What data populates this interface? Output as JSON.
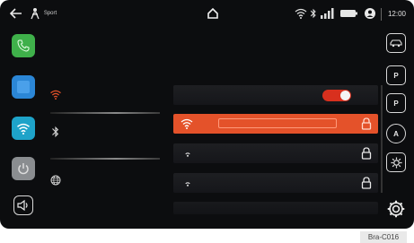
{
  "status_bar": {
    "back_icon": "back-arrow-icon",
    "profile_icon": "driving-profile-icon",
    "profile_label": "Sport",
    "home_icon": "home-icon",
    "wifi_icon": "wifi-icon",
    "bluetooth_icon": "bluetooth-icon",
    "signal_icon": "signal-bars-icon",
    "battery_icon": "battery-icon",
    "user_icon": "user-icon",
    "clock": "12:00"
  },
  "left_rail": [
    {
      "id": "phone",
      "icon": "phone-icon",
      "color": "#3fb04a"
    },
    {
      "id": "app",
      "icon": "app-tile-icon",
      "color": "#2b86d6"
    },
    {
      "id": "wifi",
      "icon": "wifi-icon",
      "color": "#1ea3c9"
    },
    {
      "id": "power",
      "icon": "power-icon",
      "color": "#8a8d90"
    },
    {
      "id": "volume",
      "icon": "speaker-icon",
      "color": "#0c0d0f"
    }
  ],
  "settings_menu": [
    {
      "id": "wifi",
      "icon": "wifi-icon",
      "color": "#e4522a"
    },
    {
      "id": "bluetooth",
      "icon": "bluetooth-icon",
      "color": "#d0d0d0"
    },
    {
      "id": "internet",
      "icon": "globe-icon",
      "color": "#d0d0d0"
    }
  ],
  "wifi_panel": {
    "toggle_state": "on",
    "accent": "#e4522a"
  },
  "right_rail": [
    {
      "id": "car",
      "icon": "car-icon"
    },
    {
      "id": "parking",
      "label": "P",
      "icon": "parking-sensor-icon"
    },
    {
      "id": "park-assist",
      "label": "P",
      "icon": "park-assist-icon"
    },
    {
      "id": "auto",
      "label": "A",
      "icon": "auto-start-stop-icon"
    },
    {
      "id": "gear",
      "icon": "gear-icon"
    },
    {
      "id": "settings",
      "icon": "settings-cog-icon"
    }
  ],
  "figure_ref": "Bra-C016"
}
